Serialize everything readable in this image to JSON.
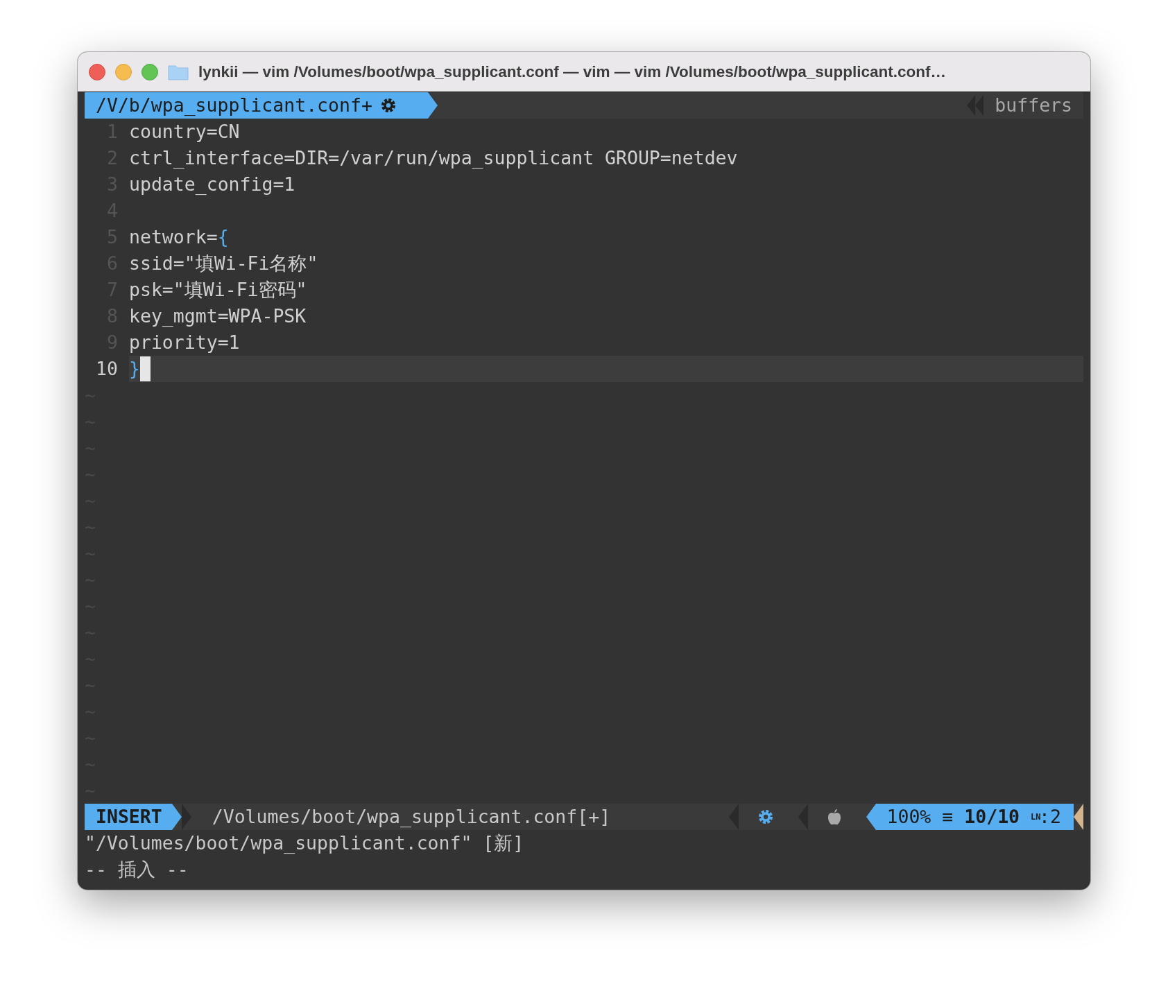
{
  "window": {
    "title": "lynkii — vim /Volumes/boot/wpa_supplicant.conf — vim — vim /Volumes/boot/wpa_supplicant.conf…"
  },
  "tabline": {
    "buffer": {
      "label": "/V/b/wpa_supplicant.conf+",
      "selected": true
    },
    "right_label": "buffers"
  },
  "lines": [
    {
      "number": "1",
      "current": false,
      "cursor": false,
      "segments": [
        {
          "kind": "plain",
          "text": "country=CN"
        }
      ]
    },
    {
      "number": "2",
      "current": false,
      "cursor": false,
      "segments": [
        {
          "kind": "plain",
          "text": "ctrl_interface=DIR=/var/run/wpa_supplicant GROUP=netdev"
        }
      ]
    },
    {
      "number": "3",
      "current": false,
      "cursor": false,
      "segments": [
        {
          "kind": "plain",
          "text": "update_config=1"
        }
      ]
    },
    {
      "number": "4",
      "current": false,
      "cursor": false
    },
    {
      "number": "5",
      "current": false,
      "cursor": false,
      "segments": [
        {
          "kind": "plain",
          "text": "network="
        },
        {
          "kind": "brace",
          "text": "{"
        }
      ]
    },
    {
      "number": "6",
      "current": false,
      "cursor": false,
      "segments": [
        {
          "kind": "plain",
          "text": "ssid=\"填Wi-Fi名称\""
        }
      ]
    },
    {
      "number": "7",
      "current": false,
      "cursor": false,
      "segments": [
        {
          "kind": "plain",
          "text": "psk=\"填Wi-Fi密码\""
        }
      ]
    },
    {
      "number": "8",
      "current": false,
      "cursor": false,
      "segments": [
        {
          "kind": "plain",
          "text": "key_mgmt=WPA-PSK"
        }
      ]
    },
    {
      "number": "9",
      "current": false,
      "cursor": false,
      "segments": [
        {
          "kind": "plain",
          "text": "priority=1"
        }
      ]
    },
    {
      "number": "10",
      "current": true,
      "cursor": true,
      "segments": [
        {
          "kind": "brace",
          "text": "}"
        }
      ]
    }
  ],
  "filler_lines": [
    "~",
    "~",
    "~",
    "~",
    "~",
    "~",
    "~",
    "~",
    "~",
    "~",
    "~",
    "~",
    "~",
    "~",
    "~",
    "~"
  ],
  "statusline": {
    "mode": "INSERT",
    "file": "/Volumes/boot/wpa_supplicant.conf[+]",
    "percent": "100%",
    "lines_symbol": "≡",
    "position": "10/10",
    "column_symbol": "LN",
    "column": ":2"
  },
  "command_lines": [
    "\"/Volumes/boot/wpa_supplicant.conf\" [新]",
    "-- 插入 --"
  ]
}
